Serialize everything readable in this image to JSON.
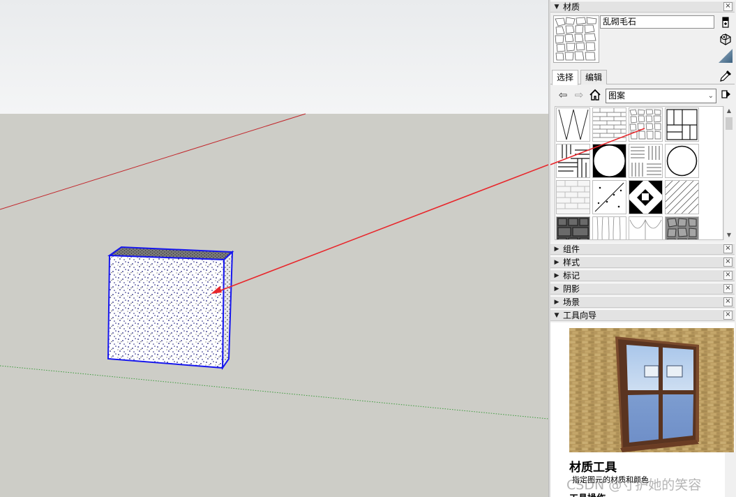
{
  "materials_panel": {
    "title": "材质",
    "close": "×",
    "material_name": "乱砌毛石",
    "tabs": [
      "选择",
      "编辑"
    ],
    "active_tab": "选择",
    "library": "图案",
    "library_caret": "⌄",
    "nav_icons": [
      "back-arrow-icon",
      "forward-arrow-icon",
      "home-icon"
    ],
    "swatch_icons": [
      "zigzag-pattern",
      "brick-pattern",
      "random-stone-pattern",
      "parquet-pattern",
      "herringbone-pattern",
      "octagon-dot-pattern",
      "basketweave-pattern",
      "circle-pattern",
      "white-brick-pattern",
      "diagonal-dot-pattern",
      "black-white-diamond-pattern",
      "diagonal-lines-pattern",
      "dark-stone-pattern",
      "wood-grain-pattern",
      "fan-pattern",
      "grey-stone-pattern"
    ]
  },
  "collapsed_panels": [
    {
      "title": "组件",
      "close": "×"
    },
    {
      "title": "样式",
      "close": "×"
    },
    {
      "title": "标记",
      "close": "×"
    },
    {
      "title": "阴影",
      "close": "×"
    },
    {
      "title": "场景",
      "close": "×"
    }
  ],
  "instructor_panel": {
    "title": "工具向导",
    "close": "×",
    "heading": "材质工具",
    "description": "指定图元的材质和颜色",
    "more": "工具操作"
  },
  "watermark": "CSDN @寸护她的笑容",
  "colors": {
    "sky": "#eef0f1",
    "ground": "#cdcdc7",
    "red_axis": "#c2262b",
    "green_axis": "#3a9a3a",
    "selection_blue": "#1616ee",
    "annotation_arrow": "#e8262b"
  }
}
